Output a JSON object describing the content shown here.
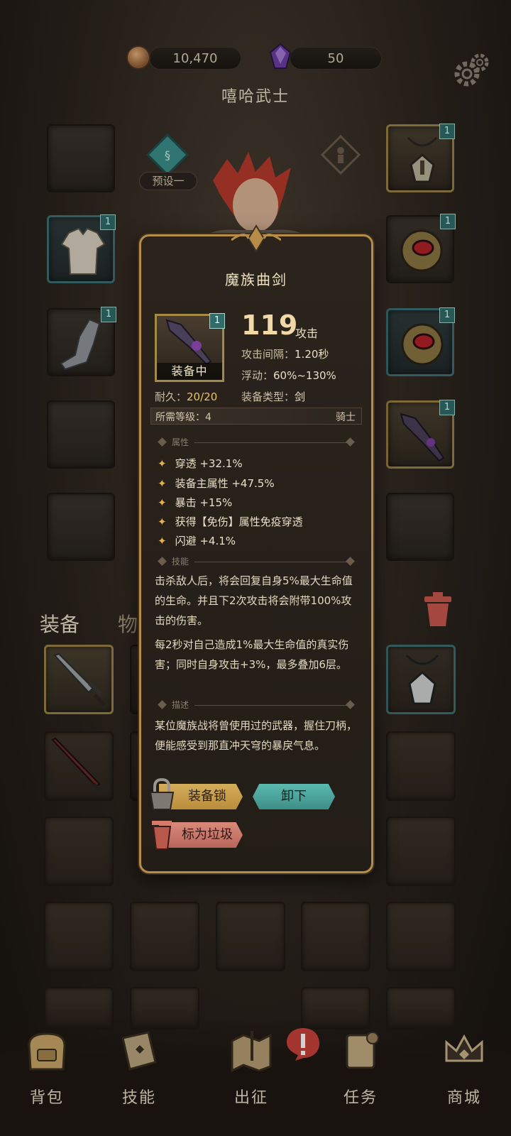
{
  "resources": {
    "gold": "10,470",
    "gems": "50"
  },
  "icons": {
    "gold": "gold-coin-icon",
    "gems": "purple-gem-icon",
    "settings": "gear-icon",
    "preset": "preset-emblem-icon",
    "trash": "trash-can-icon",
    "alert": "exclamation-icon"
  },
  "character": {
    "name": "嘻哈武士",
    "preset_label": "预设一"
  },
  "slot_badge": "1",
  "tabs": {
    "equipment": "装备",
    "items": "物品"
  },
  "item_popup": {
    "name": "魔族曲剑",
    "equipped_label": "装备中",
    "attack_value": "119",
    "attack_unit": "攻击",
    "attack_interval_label": "攻击间隔：",
    "attack_interval": "1.20秒",
    "variance_label": "浮动：",
    "variance": "60%~130%",
    "type_label": "装备类型：",
    "type": "剑",
    "durability_label": "耐久：",
    "durability": "20/20",
    "required_level_label": "所需等级：4",
    "class": "骑士",
    "sections": {
      "attributes": "属性",
      "skills": "技能",
      "description": "描述"
    },
    "attributes": [
      "穿透 +32.1%",
      "装备主属性 +47.5%",
      "暴击 +15%",
      "获得【免伤】属性免疫穿透",
      "闪避 +4.1%"
    ],
    "skill_text_1": "击杀敌人后，将会回复自身5%最大生命值的生命。并且下2次攻击将会附带100%攻击的伤害。",
    "skill_text_2": "每2秒对自己造成1%最大生命值的真实伤害；同时自身攻击+3%，最多叠加6层。",
    "description": "某位魔族战将曾使用过的武器，握住刀柄，便能感受到那直冲天穹的暴戾气息。",
    "buttons": {
      "lock": "装备锁",
      "unequip": "卸下",
      "mark_junk": "标为垃圾"
    }
  },
  "bottom_nav": [
    {
      "label": "背包",
      "icon": "backpack-icon"
    },
    {
      "label": "技能",
      "icon": "skill-book-icon"
    },
    {
      "label": "出征",
      "icon": "map-icon"
    },
    {
      "label": "任务",
      "icon": "scroll-icon"
    },
    {
      "label": "商城",
      "icon": "shop-crown-icon"
    }
  ],
  "colors": {
    "gold_border": "#9a8245",
    "teal_border": "#3e6f74",
    "badge": "#2f6c6a",
    "popup_border": "#b58d48",
    "accent_star": "#e8b04a"
  }
}
